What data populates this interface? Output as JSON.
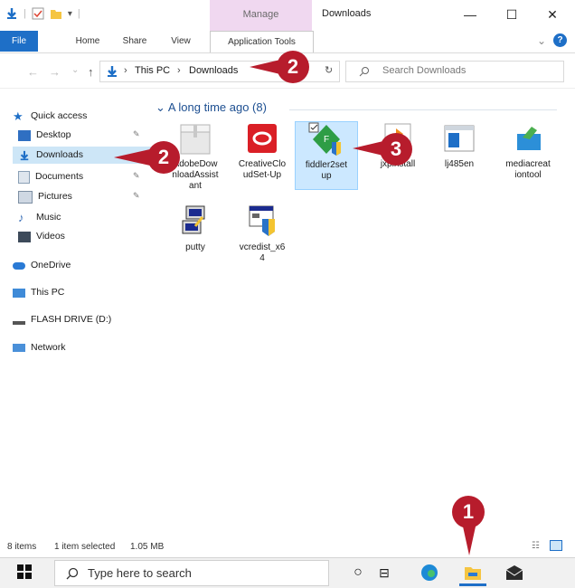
{
  "window": {
    "title": "Downloads",
    "context_tab_group": "Manage"
  },
  "window_controls": {
    "minimize": "—",
    "maximize": "☐",
    "close": "✕"
  },
  "ribbon": {
    "tabs": [
      {
        "label": "File"
      },
      {
        "label": "Home"
      },
      {
        "label": "Share"
      },
      {
        "label": "View"
      },
      {
        "label": "Application Tools"
      }
    ],
    "collapse": "⌄",
    "help": "?"
  },
  "address_bar": {
    "back": "←",
    "forward": "→",
    "recent": "⌄",
    "up": "↑",
    "crumbs": [
      "This PC",
      "Downloads"
    ],
    "separator": "›",
    "dropdown": "⌄",
    "refresh": "↻"
  },
  "search": {
    "placeholder": "Search Downloads"
  },
  "nav": {
    "quick_access": "Quick access",
    "items": [
      {
        "label": "Desktop",
        "pinned": true
      },
      {
        "label": "Downloads",
        "pinned": true,
        "selected": true
      },
      {
        "label": "Documents",
        "pinned": true
      },
      {
        "label": "Pictures",
        "pinned": true
      },
      {
        "label": "Music",
        "pinned": false
      },
      {
        "label": "Videos",
        "pinned": false
      }
    ],
    "onedrive": "OneDrive",
    "thispc": "This PC",
    "flash": "FLASH DRIVE (D:)",
    "network": "Network"
  },
  "content": {
    "group_header": "A long time ago (8)",
    "group_chevron": "⌄",
    "files": [
      {
        "name": "AdobeDownloadAssistant",
        "l1": "AdobeDow",
        "l2": "nloadAssist",
        "l3": "ant",
        "icon": "package-icon"
      },
      {
        "name": "CreativeCloudSet-Up",
        "l1": "CreativeClo",
        "l2": "udSet-Up",
        "l3": "",
        "icon": "creative-cloud-icon"
      },
      {
        "name": "fiddler2setup",
        "l1": "fiddler2set",
        "l2": "up",
        "l3": "",
        "icon": "fiddler-installer-icon",
        "selected": true
      },
      {
        "name": "jxpinstall",
        "l1": "jxpinstall",
        "l2": "",
        "l3": "",
        "icon": "installer-icon"
      },
      {
        "name": "lj485en",
        "l1": "lj485en",
        "l2": "",
        "l3": "",
        "icon": "window-app-icon"
      },
      {
        "name": "mediacreationtool",
        "l1": "mediacreat",
        "l2": "iontool",
        "l3": "",
        "icon": "media-creation-icon"
      },
      {
        "name": "putty",
        "l1": "putty",
        "l2": "",
        "l3": "",
        "icon": "putty-icon"
      },
      {
        "name": "vcredist_x64",
        "l1": "vcredist_x6",
        "l2": "4",
        "l3": "",
        "icon": "vcredist-icon"
      }
    ]
  },
  "status": {
    "items": "8 items",
    "selected": "1 item selected",
    "size": "1.05 MB"
  },
  "taskbar": {
    "search_placeholder": "Type here to search"
  },
  "callouts": {
    "c1": "1",
    "c2a": "2",
    "c2b": "2",
    "c3": "3"
  },
  "colors": {
    "accent": "#1e6fc7",
    "callout": "#b71c2c",
    "manage_bg": "#f0d8f0",
    "selection": "#cce8ff"
  }
}
